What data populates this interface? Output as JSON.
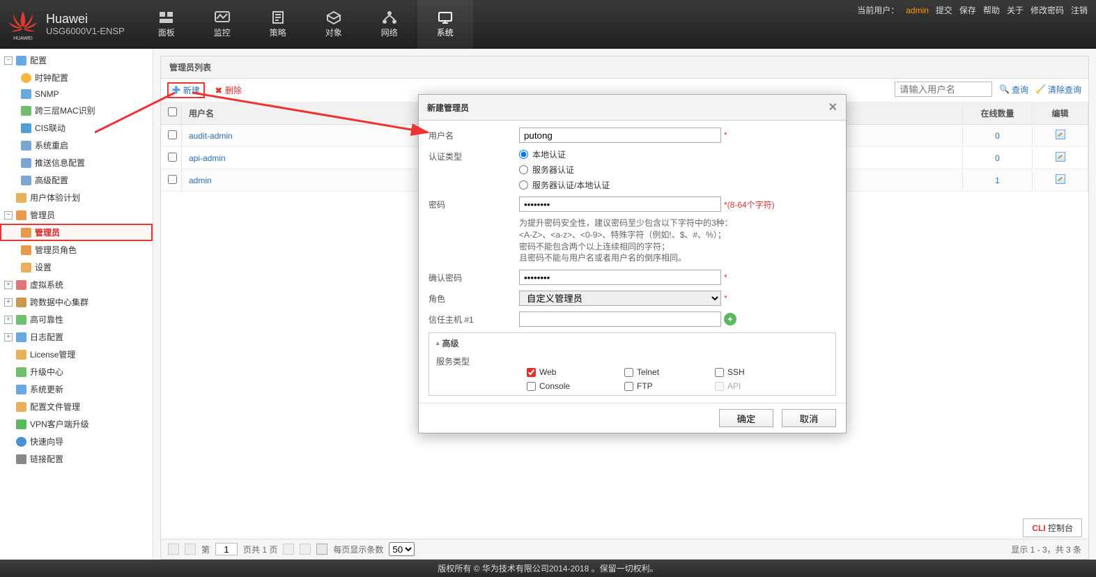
{
  "header": {
    "brand": "Huawei",
    "model": "USG6000V1-ENSP",
    "currentUserLabel": "当前用户：",
    "currentUser": "admin",
    "links": {
      "submit": "提交",
      "save": "保存",
      "help": "帮助",
      "about": "关于",
      "changePwd": "修改密码",
      "logout": "注销"
    },
    "nav": {
      "dashboard": "面板",
      "monitor": "监控",
      "policy": "策略",
      "object": "对象",
      "network": "网络",
      "system": "系统"
    }
  },
  "sidebar": {
    "config": "配置",
    "clock": "时钟配置",
    "snmp": "SNMP",
    "l3mac": "跨三层MAC识别",
    "cis": "CIS联动",
    "restart": "系统重启",
    "pushcfg": "推送信息配置",
    "advcfg": "高级配置",
    "uexp": "用户体验计划",
    "adminGrp": "管理员",
    "adminNode": "管理员",
    "adminRole": "管理员角色",
    "settings": "设置",
    "vsys": "虚拟系统",
    "cluster": "跨数据中心集群",
    "ha": "高可靠性",
    "log": "日志配置",
    "license": "License管理",
    "upgradeCenter": "升级中心",
    "sysupdate": "系统更新",
    "cfgfile": "配置文件管理",
    "vpnclient": "VPN客户端升级",
    "quickguide": "快速向导",
    "linkcfg": "链接配置"
  },
  "panel": {
    "title": "管理员列表",
    "newBtn": "新建",
    "delBtn": "删除",
    "searchPlaceholder": "请输入用户名",
    "queryBtn": "查询",
    "clearBtn": "清除查询",
    "cols": {
      "username": "用户名",
      "online": "在线数量",
      "edit": "编辑"
    },
    "rows": [
      {
        "name": "audit-admin",
        "online": "0"
      },
      {
        "name": "api-admin",
        "online": "0"
      },
      {
        "name": "admin",
        "online": "1"
      }
    ]
  },
  "pager": {
    "pagePrefix": "第",
    "pageValue": "1",
    "pageTotal": "页共 1 页",
    "perPageLabel": "每页显示条数",
    "perPageValue": "50",
    "summary": "显示 1 - 3，共 3 条"
  },
  "dialog": {
    "title": "新建管理员",
    "username_label": "用户名",
    "username_value": "putong",
    "authtype_label": "认证类型",
    "auth_local": "本地认证",
    "auth_server": "服务器认证",
    "auth_both": "服务器认证/本地认证",
    "password_label": "密码",
    "password_req": "*(8-64个字符)",
    "password_hint": "为提升密码安全性，建议密码至少包含以下字符中的3种：\n<A-Z>、<a-z>、<0-9>、特殊字符（例如!、$、#、%）；\n密码不能包含两个以上连续相同的字符；\n且密码不能与用户名或者用户名的倒序相同。",
    "confirm_label": "确认密码",
    "role_label": "角色",
    "role_value": "自定义管理员",
    "trusthost_label": "信任主机 #1",
    "advanced_label": "高级",
    "svc_label": "服务类型",
    "svc_web": "Web",
    "svc_telnet": "Telnet",
    "svc_ssh": "SSH",
    "svc_console": "Console",
    "svc_ftp": "FTP",
    "svc_api": "API",
    "ok": "确定",
    "cancel": "取消"
  },
  "footer": {
    "copyright": "版权所有 © 华为技术有限公司2014-2018 。保留一切权利。",
    "cliBtn": "CLI 控制台"
  }
}
